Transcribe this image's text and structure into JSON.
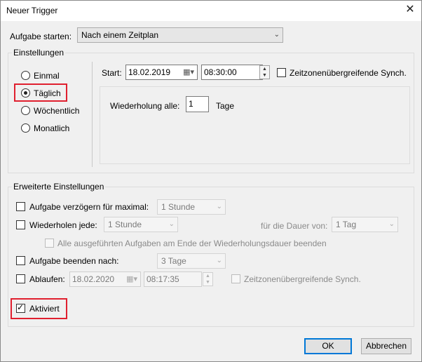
{
  "window": {
    "title": "Neuer Trigger",
    "close_glyph": "✕"
  },
  "start_task": {
    "label": "Aufgabe starten:",
    "value": "Nach einem Zeitplan"
  },
  "settings": {
    "legend": "Einstellungen",
    "radios": [
      {
        "label": "Einmal",
        "checked": false
      },
      {
        "label": "Täglich",
        "checked": true
      },
      {
        "label": "Wöchentlich",
        "checked": false
      },
      {
        "label": "Monatlich",
        "checked": false
      }
    ],
    "start_label": "Start:",
    "start_date": "18.02.2019",
    "start_time": "08:30:00",
    "timezone_sync_label": "Zeitzonenübergreifende Synch.",
    "repeat_label": "Wiederholung alle:",
    "repeat_value": "1",
    "repeat_unit": "Tage"
  },
  "advanced": {
    "legend": "Erweiterte Einstellungen",
    "delay": {
      "label": "Aufgabe verzögern für maximal:",
      "value": "1 Stunde",
      "checked": false
    },
    "repeat": {
      "label": "Wiederholen jede:",
      "value": "1 Stunde",
      "checked": false,
      "duration_label": "für die Dauer von:",
      "duration_value": "1 Tag"
    },
    "stop_all_label": "Alle ausgeführten Aufgaben am Ende der Wiederholungsdauer beenden",
    "stop_after": {
      "label": "Aufgabe beenden nach:",
      "value": "3 Tage",
      "checked": false
    },
    "expire": {
      "label": "Ablaufen:",
      "date": "18.02.2020",
      "time": "08:17:35",
      "checked": false,
      "sync_label": "Zeitzonenübergreifende Synch."
    },
    "activated": {
      "label": "Aktiviert",
      "checked": true
    }
  },
  "buttons": {
    "ok": "OK",
    "cancel": "Abbrechen"
  },
  "colors": {
    "highlight": "#e0202f",
    "default_button": "#0078d7"
  }
}
